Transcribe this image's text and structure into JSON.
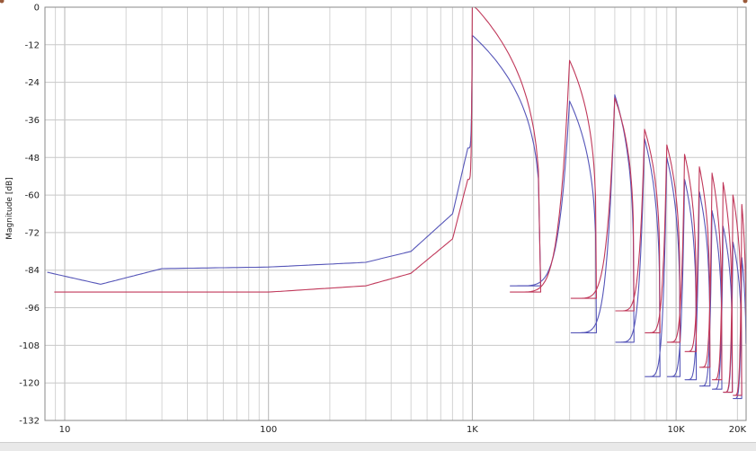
{
  "chart_data": {
    "type": "line",
    "xlabel": "",
    "ylabel": "Magnitude [dB]",
    "x_scale": "log",
    "xlim": [
      8,
      22050
    ],
    "ylim": [
      -132,
      0
    ],
    "grid": true,
    "legend": "none",
    "x_tick_labels": [
      "10",
      "100",
      "1K",
      "10K",
      "20K"
    ],
    "x_tick_values": [
      10,
      100,
      1000,
      10000,
      20000
    ],
    "y_tick_labels": [
      "0",
      "-12",
      "-24",
      "-36",
      "-48",
      "-60",
      "-72",
      "-84",
      "-96",
      "-108",
      "-120",
      "-132"
    ],
    "y_tick_values": [
      0,
      -12,
      -24,
      -36,
      -48,
      -60,
      -72,
      -84,
      -96,
      -108,
      -120,
      -132
    ],
    "harmonics": [
      1000,
      3000,
      5000,
      7000,
      9000,
      11000,
      13000,
      15000,
      17000,
      19000,
      21000
    ],
    "series": [
      {
        "color": "#5555b8",
        "peaks_db": [
          -9,
          -30,
          -28,
          -42,
          -48,
          -55,
          -59,
          -65,
          -70,
          -75,
          -80
        ],
        "dips_db": [
          -89,
          -104,
          -107,
          -118,
          -118,
          -119,
          -121,
          -122,
          -123,
          -125,
          -128
        ],
        "low_freq_points": [
          [
            8,
            -84.5
          ],
          [
            15,
            -88.5
          ],
          [
            30,
            -83.5
          ],
          [
            100,
            -83
          ],
          [
            300,
            -81.5
          ],
          [
            500,
            -78
          ],
          [
            800,
            -66
          ],
          [
            950,
            -45
          ]
        ]
      },
      {
        "color": "#c0385a",
        "peaks_db": [
          1,
          -17,
          -29,
          -39,
          -44,
          -47,
          -51,
          -53,
          -56,
          -60,
          -63
        ],
        "dips_db": [
          -91,
          -93,
          -97,
          -104,
          -107,
          -110,
          -115,
          -119,
          -123,
          -124,
          -125
        ],
        "low_freq_points": [
          [
            8,
            -91
          ],
          [
            100,
            -91
          ],
          [
            300,
            -89
          ],
          [
            500,
            -85
          ],
          [
            800,
            -74
          ],
          [
            950,
            -55
          ]
        ]
      }
    ]
  }
}
